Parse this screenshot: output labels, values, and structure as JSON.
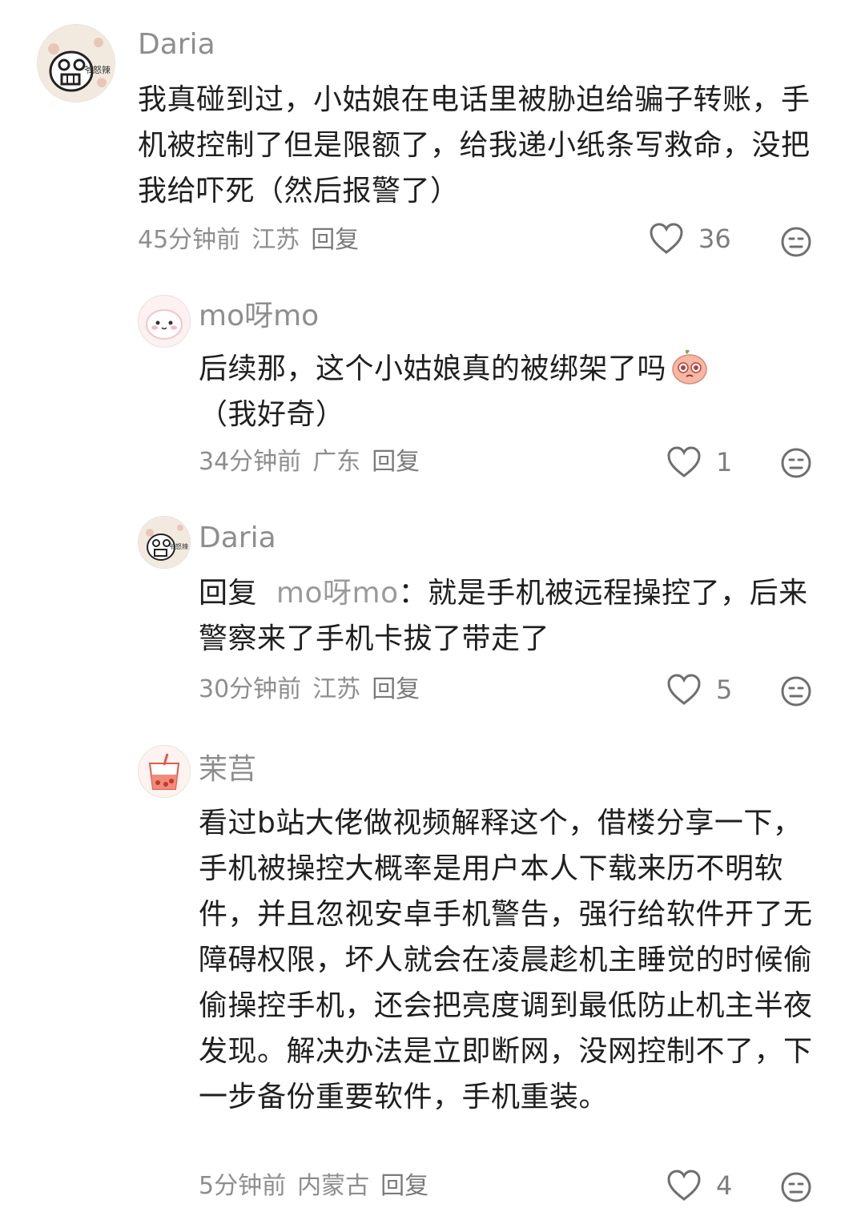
{
  "comments": [
    {
      "username": "Daria",
      "avatar_text": "爷怒辣",
      "content": "我真碰到过，小姑娘在电话里被胁迫给骗子转账，手机被控制了但是限额了，给我递小纸条写救命，没把我给吓死（然后报警了）",
      "time": "45分钟前",
      "location": "江苏",
      "reply_label": "回复",
      "likes": "36"
    },
    {
      "username": "mo呀mo",
      "content": "后续那，这个小姑娘真的被绑架了吗",
      "content_suffix": "（我好奇）",
      "emoji": "pleading-face-emoji",
      "time": "34分钟前",
      "location": "广东",
      "reply_label": "回复",
      "likes": "1"
    },
    {
      "username": "Daria",
      "avatar_text": "爷怒辣",
      "reply_prefix": "回复",
      "reply_target": "mo呀mo",
      "content": "：就是手机被远程操控了，后来警察来了手机卡拔了带走了",
      "time": "30分钟前",
      "location": "江苏",
      "reply_label": "回复",
      "likes": "5"
    },
    {
      "username": "茉莒",
      "content": "看过b站大佬做视频解释这个，借楼分享一下，手机被操控大概率是用户本人下载来历不明软件，并且忽视安卓手机警告，强行给软件开了无障碍权限，坏人就会在凌晨趁机主睡觉的时候偷偷操控手机，还会把亮度调到最低防止机主半夜发现。解决办法是立即断网，没网控制不了，下一步备份重要软件，手机重装。",
      "time": "5分钟前",
      "location": "内蒙古",
      "reply_label": "回复",
      "likes": "4"
    }
  ],
  "icons": {
    "like": "heart-outline-icon",
    "dislike": "meh-face-icon"
  },
  "colors": {
    "text": "#1f1f1f",
    "meta": "#8e8e8e",
    "icon": "#6f6f6f"
  }
}
